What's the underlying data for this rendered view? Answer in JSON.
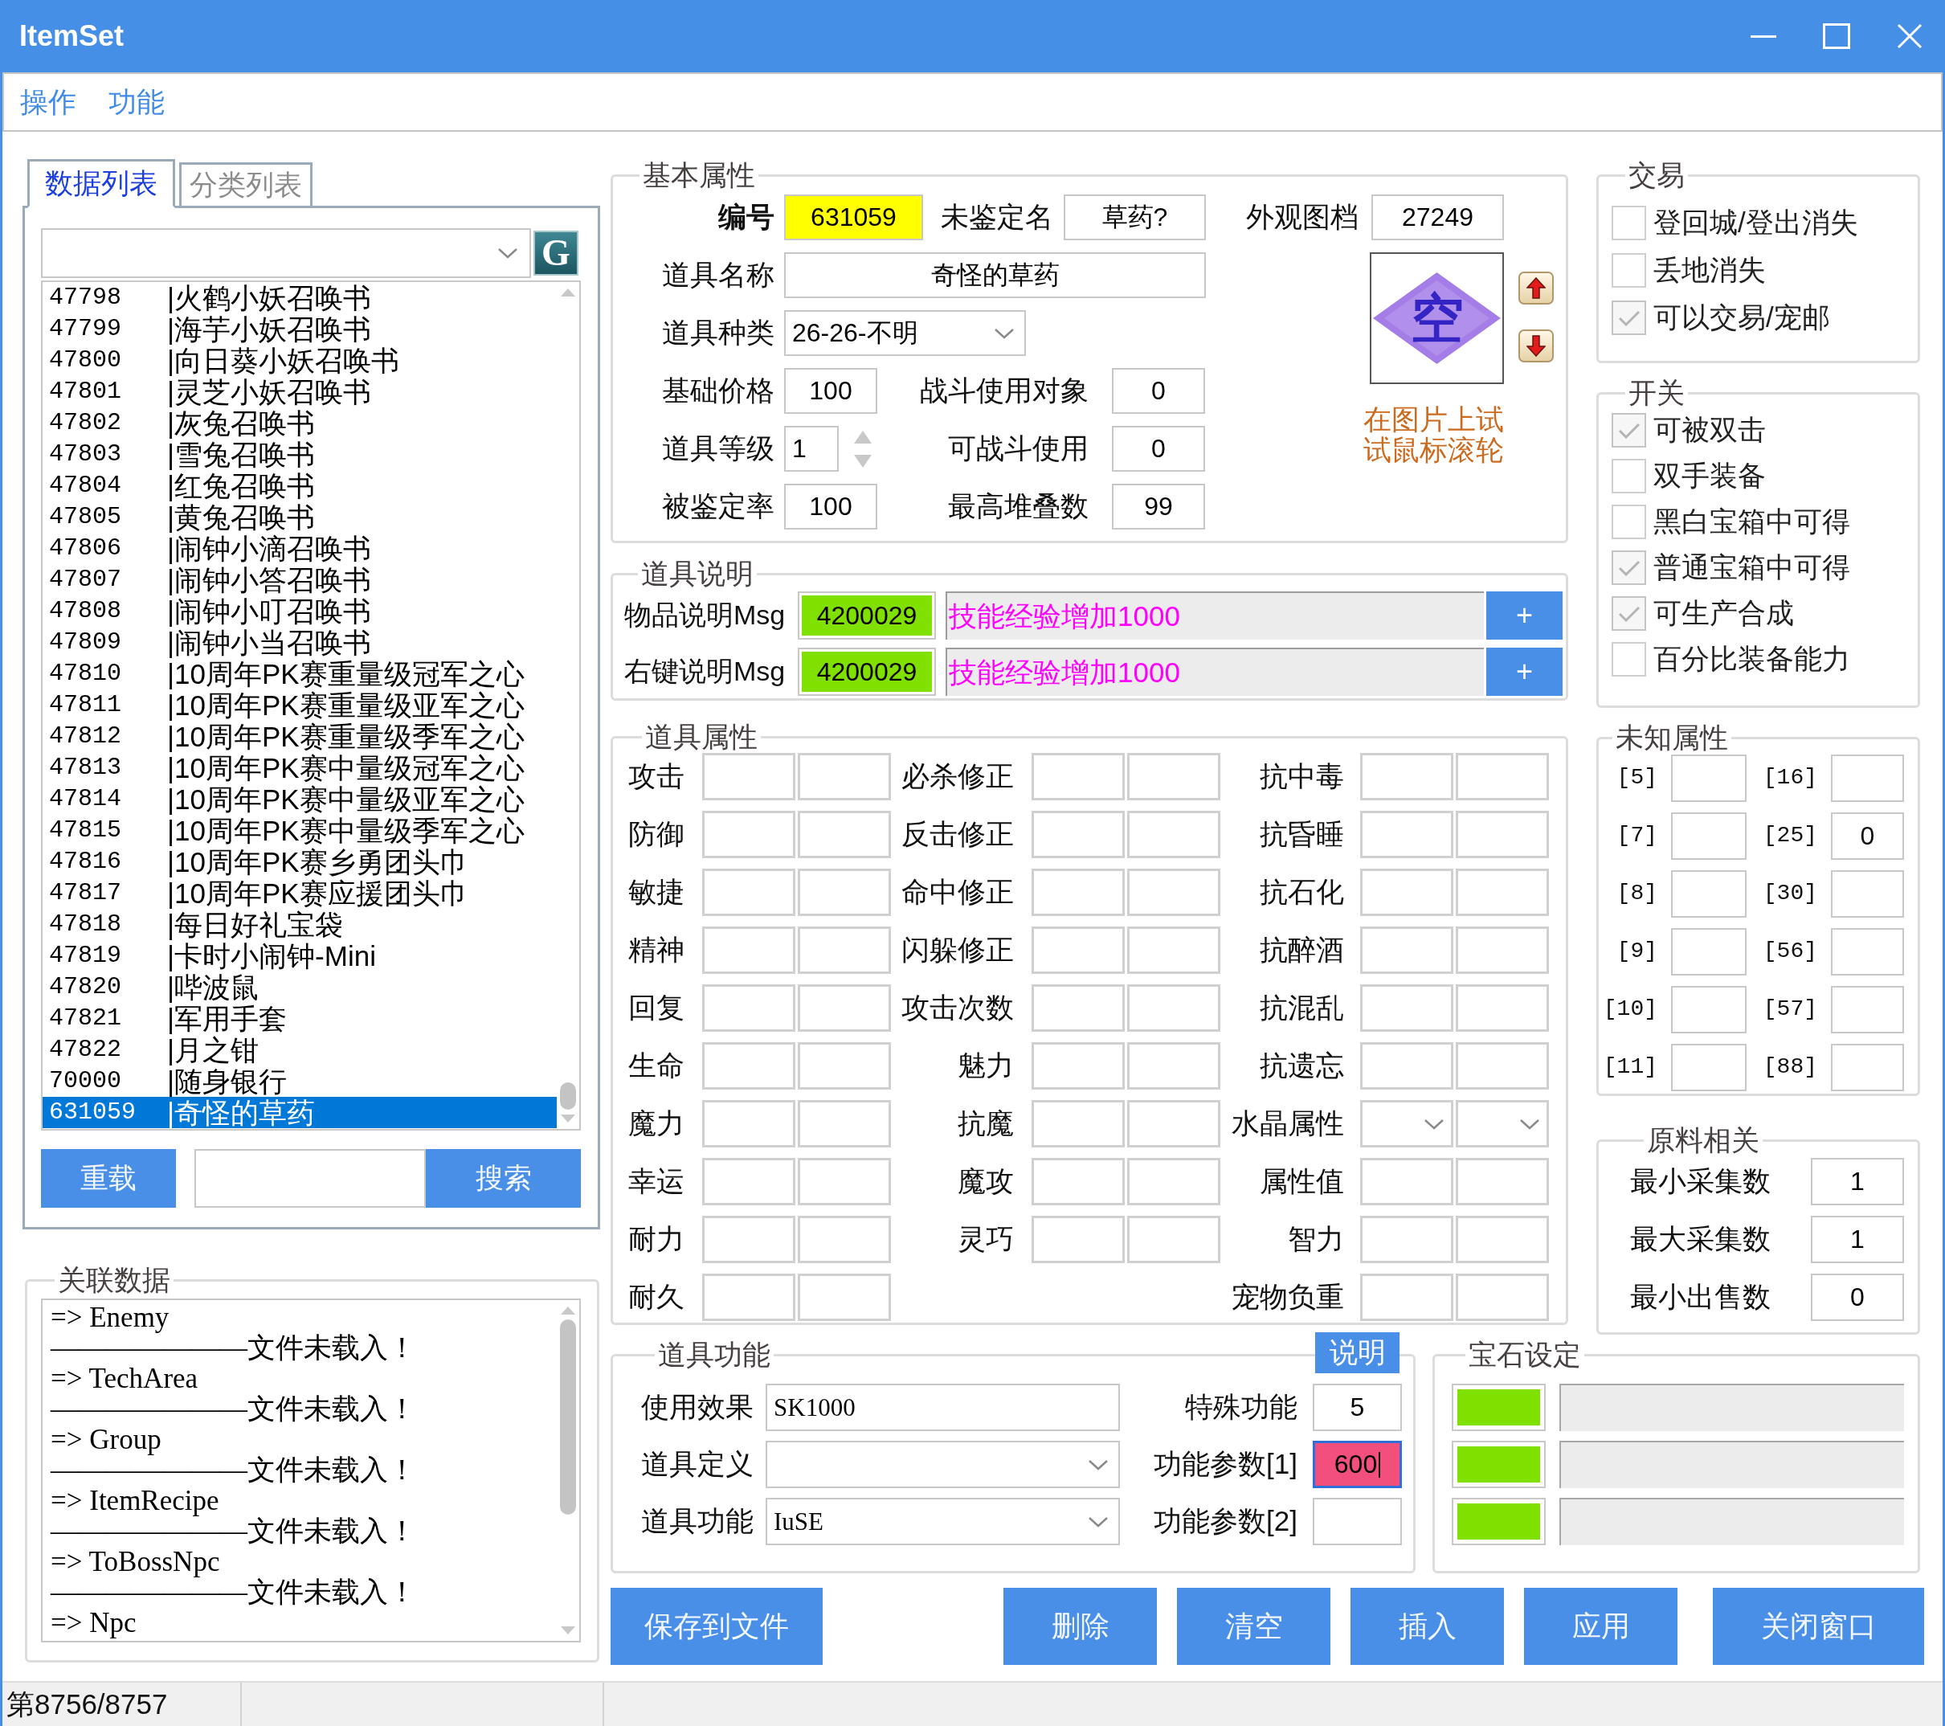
{
  "window": {
    "title": "ItemSet"
  },
  "menu": [
    "操作",
    "功能"
  ],
  "list_panel": {
    "tabs": [
      {
        "label": "数据列表",
        "selected": true
      },
      {
        "label": "分类列表",
        "selected": false
      }
    ],
    "g_button": "G",
    "items": [
      {
        "id": "47798",
        "name": "|火鹤小妖召唤书",
        "selected": false
      },
      {
        "id": "47799",
        "name": "|海芋小妖召唤书",
        "selected": false
      },
      {
        "id": "47800",
        "name": "|向日葵小妖召唤书",
        "selected": false
      },
      {
        "id": "47801",
        "name": "|灵芝小妖召唤书",
        "selected": false
      },
      {
        "id": "47802",
        "name": "|灰兔召唤书",
        "selected": false
      },
      {
        "id": "47803",
        "name": "|雪兔召唤书",
        "selected": false
      },
      {
        "id": "47804",
        "name": "|红兔召唤书",
        "selected": false
      },
      {
        "id": "47805",
        "name": "|黄兔召唤书",
        "selected": false
      },
      {
        "id": "47806",
        "name": "|闹钟小滴召唤书",
        "selected": false
      },
      {
        "id": "47807",
        "name": "|闹钟小答召唤书",
        "selected": false
      },
      {
        "id": "47808",
        "name": "|闹钟小叮召唤书",
        "selected": false
      },
      {
        "id": "47809",
        "name": "|闹钟小当召唤书",
        "selected": false
      },
      {
        "id": "47810",
        "name": "|10周年PK赛重量级冠军之心",
        "selected": false
      },
      {
        "id": "47811",
        "name": "|10周年PK赛重量级亚军之心",
        "selected": false
      },
      {
        "id": "47812",
        "name": "|10周年PK赛重量级季军之心",
        "selected": false
      },
      {
        "id": "47813",
        "name": "|10周年PK赛中量级冠军之心",
        "selected": false
      },
      {
        "id": "47814",
        "name": "|10周年PK赛中量级亚军之心",
        "selected": false
      },
      {
        "id": "47815",
        "name": "|10周年PK赛中量级季军之心",
        "selected": false
      },
      {
        "id": "47816",
        "name": "|10周年PK赛乡勇团头巾",
        "selected": false
      },
      {
        "id": "47817",
        "name": "|10周年PK赛应援团头巾",
        "selected": false
      },
      {
        "id": "47818",
        "name": "|每日好礼宝袋",
        "selected": false
      },
      {
        "id": "47819",
        "name": "|卡时小闹钟-Mini",
        "selected": false
      },
      {
        "id": "47820",
        "name": "|哔波鼠",
        "selected": false
      },
      {
        "id": "47821",
        "name": "|军用手套",
        "selected": false
      },
      {
        "id": "47822",
        "name": "|月之钳",
        "selected": false
      },
      {
        "id": "70000",
        "name": "|随身银行",
        "selected": false
      },
      {
        "id": "631059",
        "name": "|奇怪的草药",
        "selected": true
      }
    ],
    "reload_button": "重载",
    "search_button": "搜索"
  },
  "related_data": {
    "title": "关联数据",
    "lines": [
      "=> Enemy",
      "———————文件未载入！",
      "=> TechArea",
      "———————文件未载入！",
      "=> Group",
      "———————文件未载入！",
      "=> ItemRecipe",
      "———————文件未载入！",
      "=> ToBossNpc",
      "———————文件未载入！",
      "=> Npc"
    ]
  },
  "basic": {
    "title": "基本属性",
    "number": {
      "label": "编号",
      "value": "631059"
    },
    "unidentified_name": {
      "label": "未鉴定名",
      "value": "草药?"
    },
    "appearance_file": {
      "label": "外观图档",
      "value": "27249"
    },
    "item_name": {
      "label": "道具名称",
      "value": "奇怪的草药"
    },
    "item_type": {
      "label": "道具种类",
      "value": "26-26-不明"
    },
    "base_price": {
      "label": "基础价格",
      "value": "100"
    },
    "battle_target": {
      "label": "战斗使用对象",
      "value": "0"
    },
    "item_level": {
      "label": "道具等级",
      "value": "1"
    },
    "battle_usable": {
      "label": "可战斗使用",
      "value": "0"
    },
    "identify_rate": {
      "label": "被鉴定率",
      "value": "100"
    },
    "max_stack": {
      "label": "最高堆叠数",
      "value": "99"
    },
    "preview_glyph": "空",
    "hint": "在图片上试试鼠标滚轮"
  },
  "trade": {
    "title": "交易",
    "options": [
      {
        "label": "登回城/登出消失",
        "checked": false
      },
      {
        "label": "丢地消失",
        "checked": false
      },
      {
        "label": "可以交易/宠邮",
        "checked": true
      }
    ]
  },
  "description": {
    "title": "道具说明",
    "rows": [
      {
        "label": "物品说明Msg",
        "code": "4200029",
        "text": "技能经验增加1000",
        "button": "+"
      },
      {
        "label": "右键说明Msg",
        "code": "4200029",
        "text": "技能经验增加1000",
        "button": "+"
      }
    ]
  },
  "switches": {
    "title": "开关",
    "options": [
      {
        "label": "可被双击",
        "checked": true
      },
      {
        "label": "双手装备",
        "checked": false
      },
      {
        "label": "黑白宝箱中可得",
        "checked": false
      },
      {
        "label": "普通宝箱中可得",
        "checked": true
      },
      {
        "label": "可生产合成",
        "checked": true
      },
      {
        "label": "百分比装备能力",
        "checked": false
      }
    ]
  },
  "attributes": {
    "title": "道具属性",
    "columns": [
      [
        {
          "label": "攻击",
          "kind": "field"
        },
        {
          "label": "防御",
          "kind": "field"
        },
        {
          "label": "敏捷",
          "kind": "field"
        },
        {
          "label": "精神",
          "kind": "field"
        },
        {
          "label": "回复",
          "kind": "field"
        },
        {
          "label": "生命",
          "kind": "field"
        },
        {
          "label": "魔力",
          "kind": "field"
        },
        {
          "label": "幸运",
          "kind": "field"
        },
        {
          "label": "耐力",
          "kind": "field"
        },
        {
          "label": "耐久",
          "kind": "field"
        }
      ],
      [
        {
          "label": "必杀修正",
          "kind": "field"
        },
        {
          "label": "反击修正",
          "kind": "field"
        },
        {
          "label": "命中修正",
          "kind": "field"
        },
        {
          "label": "闪躲修正",
          "kind": "field"
        },
        {
          "label": "攻击次数",
          "kind": "field"
        },
        {
          "label": "魅力",
          "kind": "field"
        },
        {
          "label": "抗魔",
          "kind": "field"
        },
        {
          "label": "魔攻",
          "kind": "field"
        },
        {
          "label": "灵巧",
          "kind": "field"
        }
      ],
      [
        {
          "label": "抗中毒",
          "kind": "field"
        },
        {
          "label": "抗昏睡",
          "kind": "field"
        },
        {
          "label": "抗石化",
          "kind": "field"
        },
        {
          "label": "抗醉酒",
          "kind": "field"
        },
        {
          "label": "抗混乱",
          "kind": "field"
        },
        {
          "label": "抗遗忘",
          "kind": "field"
        },
        {
          "label": "水晶属性",
          "kind": "dropdown"
        },
        {
          "label": "属性值",
          "kind": "field"
        },
        {
          "label": "智力",
          "kind": "field"
        },
        {
          "label": "宠物负重",
          "kind": "field"
        }
      ]
    ]
  },
  "unknown_attributes": {
    "title": "未知属性",
    "items": [
      {
        "label": "[5]"
      },
      {
        "label": "[16]"
      },
      {
        "label": "[7]"
      },
      {
        "label": "[25]",
        "value": "0"
      },
      {
        "label": "[8]"
      },
      {
        "label": "[30]"
      },
      {
        "label": "[9]"
      },
      {
        "label": "[56]"
      },
      {
        "label": "[10]"
      },
      {
        "label": "[57]"
      },
      {
        "label": "[11]"
      },
      {
        "label": "[88]"
      }
    ]
  },
  "material": {
    "title": "原料相关",
    "rows": [
      {
        "label": "最小采集数",
        "value": "1"
      },
      {
        "label": "最大采集数",
        "value": "1"
      },
      {
        "label": "最小出售数",
        "value": "0"
      }
    ]
  },
  "item_function": {
    "title": "道具功能",
    "help_button": "说明",
    "rows": [
      {
        "label": "使用效果",
        "kind": "text",
        "value": "SK1000"
      },
      {
        "label": "道具定义",
        "kind": "select"
      },
      {
        "label": "道具功能",
        "kind": "select",
        "value": "IuSE"
      }
    ],
    "params": [
      {
        "label": "特殊功能",
        "value": "5",
        "highlighted": false
      },
      {
        "label": "功能参数[1]",
        "value": "600",
        "highlighted": true
      },
      {
        "label": "功能参数[2]",
        "highlighted": false
      }
    ]
  },
  "gems": {
    "title": "宝石设定",
    "slots": [
      {
        "color": "#80e000"
      },
      {
        "color": "#80e000"
      },
      {
        "color": "#80e000"
      }
    ]
  },
  "actions": {
    "save": "保存到文件",
    "buttons": [
      "删除",
      "清空",
      "插入",
      "应用",
      "关闭窗口"
    ]
  },
  "status_bar": {
    "position": "第8756/8757"
  }
}
